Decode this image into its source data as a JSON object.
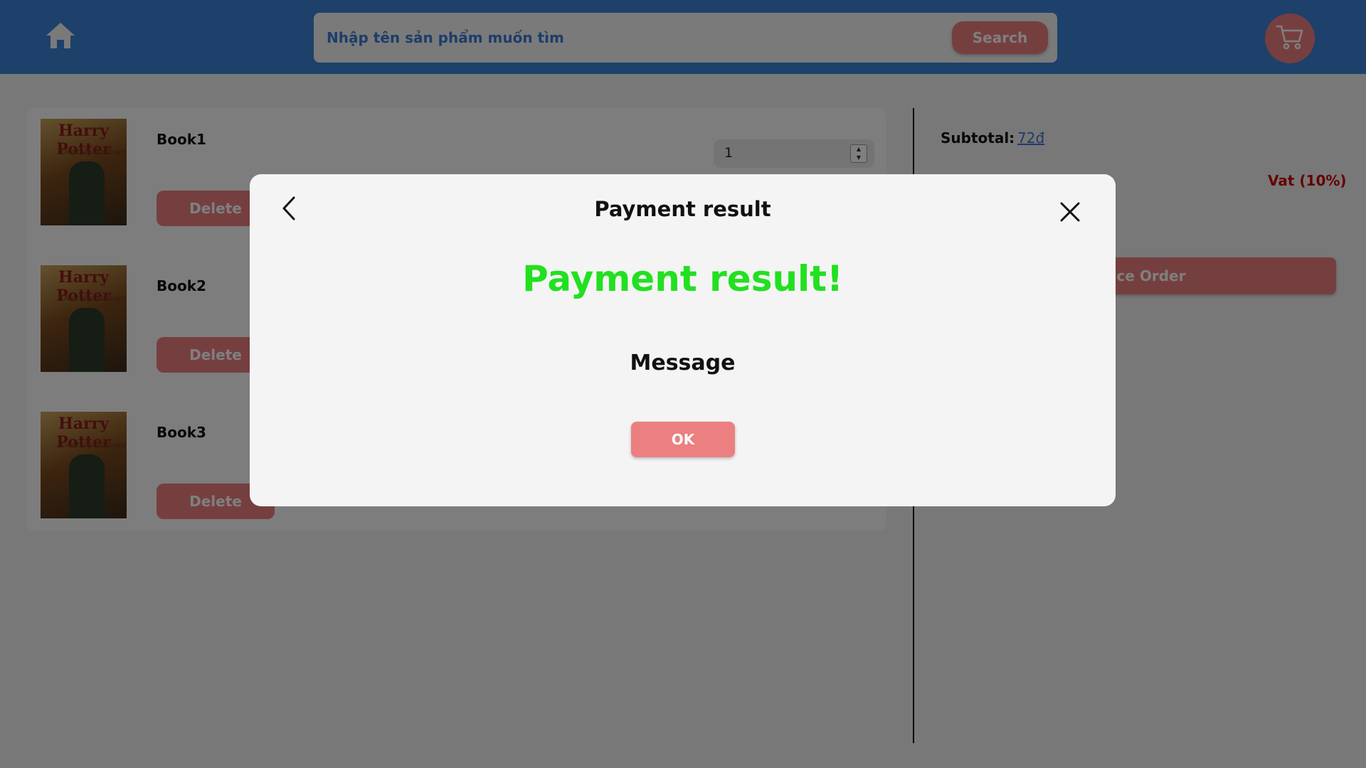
{
  "header": {
    "search_placeholder": "Nhập tên sản phẩm muốn tìm",
    "search_label": "Search",
    "home_icon": "home-icon",
    "cart_icon": "cart-icon"
  },
  "cart": {
    "items": [
      {
        "name": "Book1",
        "cover_title": "Harry Potter",
        "cover_subtitle": "Deathly Hallows",
        "delete_label": "Delete",
        "quantity": "1"
      },
      {
        "name": "Book2",
        "cover_title": "Harry Potter",
        "cover_subtitle": "Deathly Hallows",
        "delete_label": "Delete"
      },
      {
        "name": "Book3",
        "cover_title": "Harry Potter",
        "cover_subtitle": "Deathly Hallows",
        "delete_label": "Delete"
      }
    ]
  },
  "summary": {
    "subtotal_label": "Subtotal:",
    "subtotal_value": "72đ",
    "vat_label": "Vat (10%)",
    "place_order_label": "Place Order"
  },
  "modal": {
    "title": "Payment result",
    "heading": "Payment result!",
    "message": "Message",
    "ok_label": "OK",
    "back_icon": "chevron-left-icon",
    "close_icon": "close-icon"
  },
  "colors": {
    "header_bg": "#3b82d6",
    "accent": "#ec7f7f",
    "success": "#22e020",
    "vat": "#cc0000",
    "link": "#3a7bd5"
  }
}
